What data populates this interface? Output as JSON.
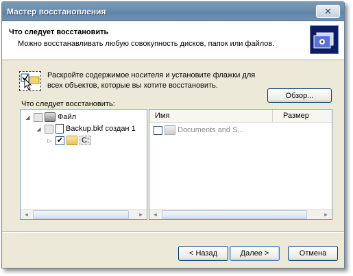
{
  "window": {
    "title": "Мастер восстановления",
    "close_label": "✕"
  },
  "header": {
    "title": "Что следует восстановить",
    "subtitle": "Можно восстанавливать любую совокупность дисков, папок или файлов.",
    "icon": "backup-wizard-icon"
  },
  "hint": {
    "line1": "Раскройте содержимое носителя и установите флажки для",
    "line2": "всех объектов, которые вы хотите восстановить."
  },
  "browse_label": "Обзор...",
  "tree": {
    "label": "Что следует восстановить:",
    "items": [
      {
        "label": "Файл",
        "icon": "file-media-icon",
        "expander": "◢",
        "checked": false
      },
      {
        "label": "Backup.bkf создан 1",
        "icon": "backup-file-icon",
        "expander": "◢",
        "checked": false
      },
      {
        "label": "C:",
        "icon": "folder-icon",
        "expander": "▷",
        "checked": true,
        "check_mark": "✔"
      }
    ]
  },
  "list": {
    "columns": {
      "name": "Имя",
      "size": "Размер"
    },
    "rows": [
      {
        "name": "Documents and S...",
        "size": ""
      }
    ]
  },
  "buttons": {
    "back": "< Назад",
    "next": "Далее >",
    "cancel": "Отмена"
  },
  "scroll_arrows": {
    "left": "◂",
    "right": "▸"
  }
}
